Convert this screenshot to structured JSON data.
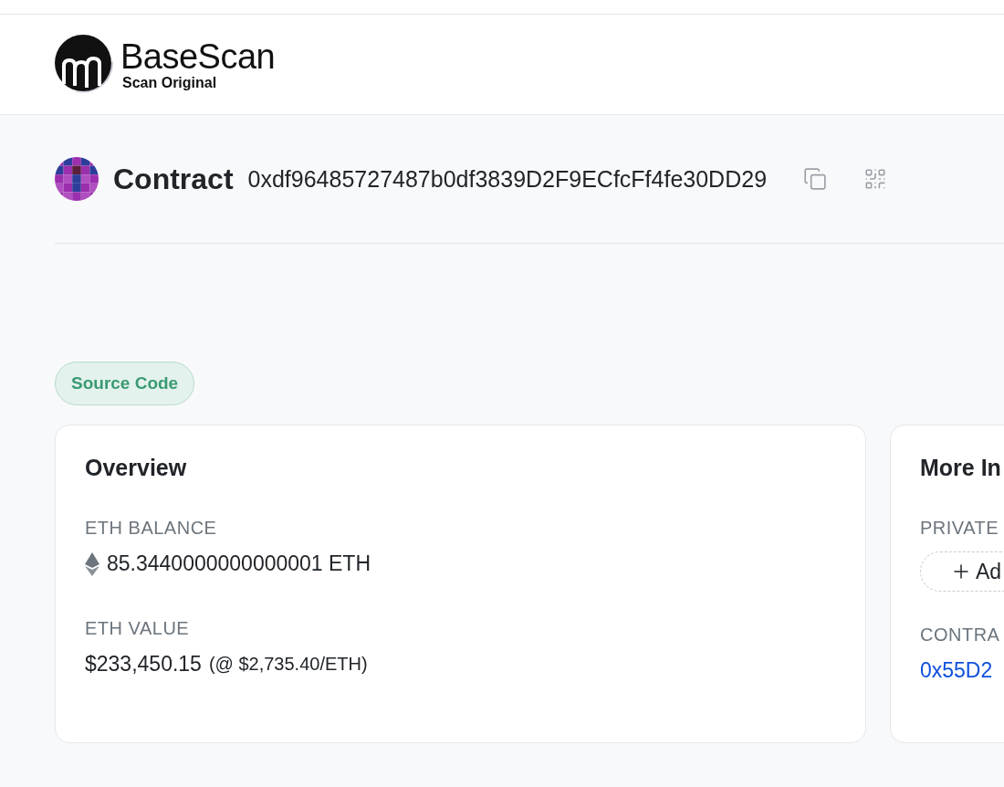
{
  "header": {
    "brand": "BaseScan",
    "tagline": "Scan Original"
  },
  "contract": {
    "label": "Contract",
    "address": "0xdf96485727487b0df3839D2F9ECfcFf4fe30DD29"
  },
  "badge": "Source Code",
  "overview": {
    "title": "Overview",
    "fields": [
      {
        "kind": "balance",
        "label": "ETH BALANCE",
        "value": "85.3440000000000001 ETH"
      },
      {
        "kind": "value",
        "label": "ETH VALUE",
        "value": "$233,450.15",
        "note": "(@ $2,735.40/ETH)"
      }
    ]
  },
  "more_info": {
    "title": "More In",
    "private_label": "PRIVATE",
    "add_button": "Ad",
    "creator_label": "CONTRA",
    "creator_link": "0x55D2"
  }
}
